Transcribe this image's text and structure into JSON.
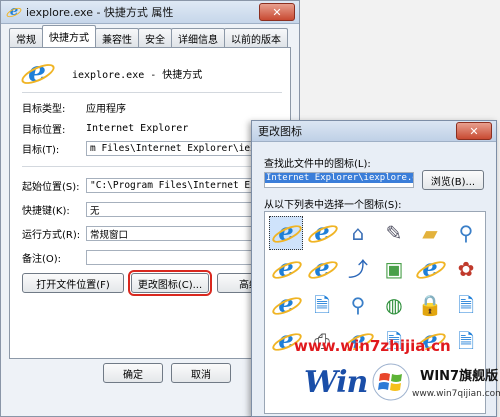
{
  "properties_window": {
    "title": "iexplore.exe - 快捷方式 属性",
    "close": "✕",
    "tabs": [
      "常规",
      "快捷方式",
      "兼容性",
      "安全",
      "详细信息",
      "以前的版本"
    ],
    "active_tab_index": 1,
    "shortcut_name": "iexplore.exe - 快捷方式",
    "fields": {
      "target_type_label": "目标类型:",
      "target_type_value": "应用程序",
      "target_location_label": "目标位置:",
      "target_location_value": "Internet Explorer",
      "target_label": "目标(T):",
      "target_value": "m Files\\Internet Explorer\\iexplo",
      "start_in_label": "起始位置(S):",
      "start_in_value": "\"C:\\Program Files\\Internet Explor",
      "shortcut_key_label": "快捷键(K):",
      "shortcut_key_value": "无",
      "run_label": "运行方式(R):",
      "run_value": "常规窗口",
      "comment_label": "备注(O):",
      "comment_value": ""
    },
    "buttons": {
      "open_location": "打开文件位置(F)",
      "change_icon": "更改图标(C)...",
      "advanced": "高级",
      "ok": "确定",
      "cancel": "取消"
    }
  },
  "change_icon_dialog": {
    "title": "更改图标",
    "close": "✕",
    "find_label": "查找此文件中的图标(L):",
    "path_value": "Internet Explorer\\iexplore.exe",
    "browse_button": "浏览(B)...",
    "select_label": "从以下列表中选择一个图标(S):",
    "icons": [
      "ie-icon",
      "ie-icon",
      "house-icon",
      "notepad-icon",
      "folder-icon",
      "magnifier-icon",
      "ie-icon",
      "ie-icon",
      "shortcut-icon",
      "picture-icon",
      "ie-icon",
      "ie-color-icon",
      "ie-icon",
      "ie-page-icon",
      "magnifier-icon",
      "globe-icon",
      "lock-icon",
      "ie-page-icon",
      "ie-icon",
      "printer-icon",
      "ie-icon",
      "ie-page-icon",
      "ie-icon",
      "ie-page-icon"
    ]
  },
  "watermark": {
    "url": "www.win7zhijia.cn",
    "brand": "WIN7旗舰版",
    "brand_url": "www.win7qijian.com",
    "logo_word": "Win"
  },
  "colors": {
    "accent": "#1f7fd8",
    "highlight": "#d9281f",
    "selection": "#3b7ed9"
  }
}
